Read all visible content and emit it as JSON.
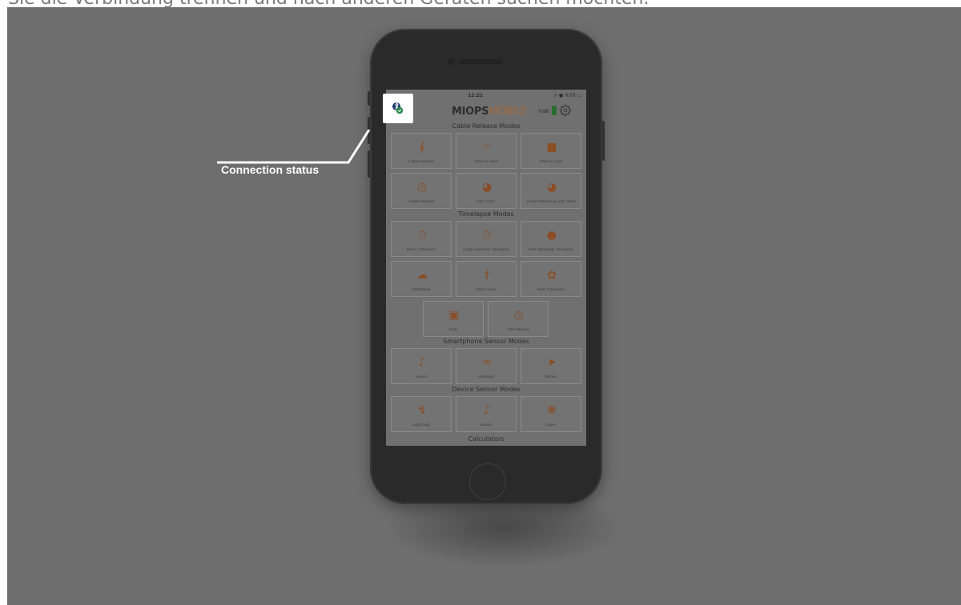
{
  "caption": "Sie die Verbindung trennen und nach anderen Geräten suchen möchten.",
  "callout": {
    "label": "Connection status"
  },
  "status_bar": {
    "time": "12:21",
    "right": "↗ ● %78 ▭"
  },
  "app": {
    "logo_part1": "MIOPS",
    "logo_part2": "MOBILE",
    "battery_pct": "%98",
    "accent_color": "#a56a3a"
  },
  "sections": [
    "Cable Release Modes",
    "Timelapse Modes",
    "Smartphone Sensor Modes",
    "Device Sensor Modes",
    "Calculators"
  ],
  "tiles": {
    "cable_release": "Cable Release",
    "press_hold": "Press & Hold",
    "press_lock": "Press & Lock",
    "timed_release": "Timed Release",
    "self_timer": "Self Timer",
    "timed_release_self_timer": "Timed Release & Self Timer",
    "basic_timelapse": "Basic Timelapse",
    "long_exposure_timelapse": "Long Exposure Timelapse",
    "bulb_ramping_timelapse": "Bulb Ramping Timelapse",
    "startlapse": "Startlapse",
    "road_lapse": "Road Lapse",
    "hdr_timelapse": "HDR Timelapse",
    "hdr": "HDR",
    "time_warper": "Time Warper",
    "sound": "Sound",
    "vibration": "Vibration",
    "motion": "Motion",
    "lightning": "Lightning",
    "device_sound": "Sound",
    "laser": "Laser"
  }
}
